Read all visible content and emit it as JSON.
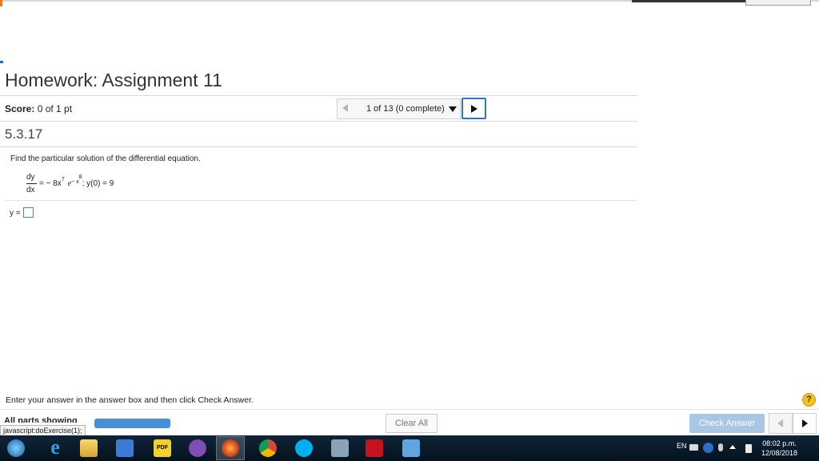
{
  "header": {
    "title": "Homework: Assignment 11"
  },
  "score": {
    "label": "Score:",
    "value": "0 of 1 pt"
  },
  "question_nav": {
    "position_text": "1 of 13 (0 complete)"
  },
  "exercise": {
    "id": "5.3.17",
    "instruction": "Find the particular solution of the differential equation.",
    "equation": {
      "lhs_numerator": "dy",
      "lhs_denominator": "dx",
      "rhs_prefix": "= − 8x",
      "power_x": "7",
      "e_symbol": "e",
      "exponent": "− x",
      "exponent_power": "8",
      "condition": "; y(0) = 9"
    },
    "answer_label": "y ="
  },
  "footer": {
    "instruction": "Enter your answer in the answer box and then click Check Answer.",
    "parts_label": "All parts showing",
    "status_url": "javascript:doExercise(1);",
    "clear_label": "Clear All",
    "check_label": "Check Answer",
    "help_label": "?"
  },
  "taskbar": {
    "language": "EN",
    "time": "08:02 p.m.",
    "date": "12/08/2018",
    "icons": [
      "windows-start-icon",
      "internet-explorer-icon",
      "file-explorer-icon",
      "media-player-icon",
      "pdf-reader-icon",
      "viber-icon",
      "firefox-icon",
      "chrome-icon",
      "skype-icon",
      "calculator-icon",
      "mcafee-icon",
      "paint-icon"
    ]
  }
}
